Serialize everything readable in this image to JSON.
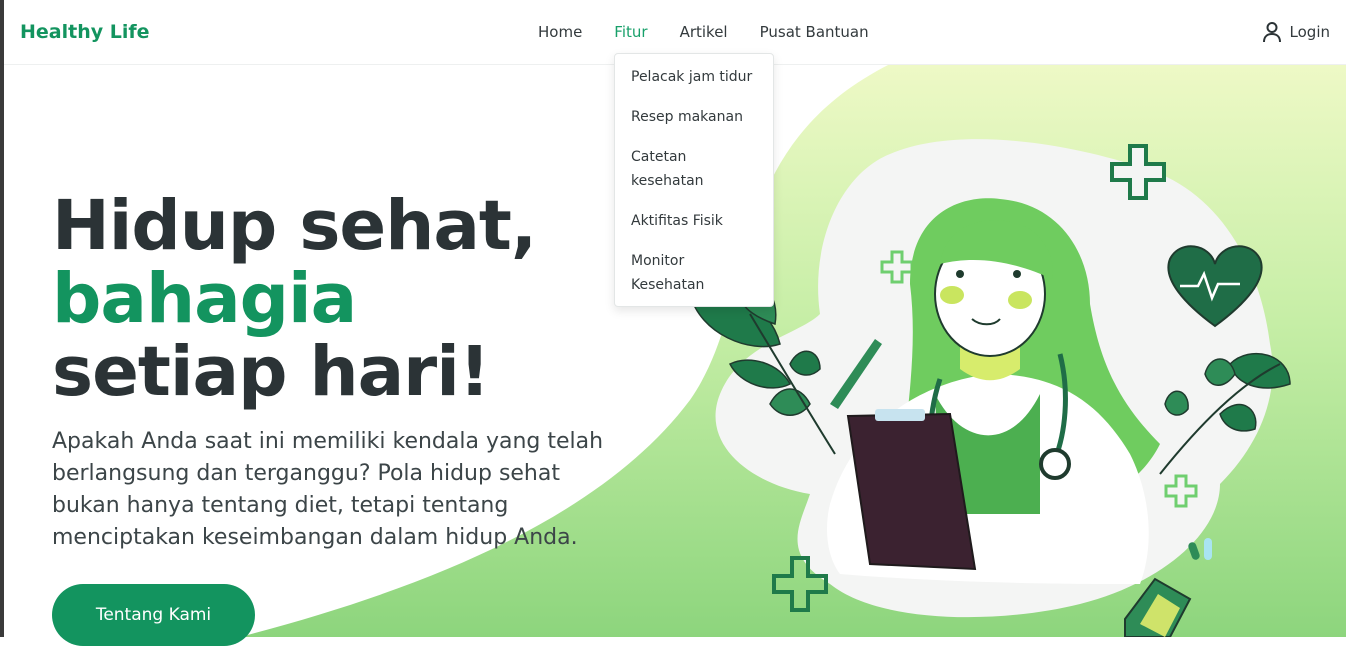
{
  "brand": "Healthy Life",
  "nav": {
    "items": [
      {
        "label": "Home"
      },
      {
        "label": "Fitur"
      },
      {
        "label": "Artikel"
      },
      {
        "label": "Pusat Bantuan"
      }
    ],
    "active": "Fitur",
    "login_label": "Login"
  },
  "dropdown": {
    "items": [
      {
        "label": "Pelacak jam tidur"
      },
      {
        "label": "Resep makanan"
      },
      {
        "label": "Catetan kesehatan"
      },
      {
        "label": "Aktifitas Fisik"
      },
      {
        "label": "Monitor Kesehatan"
      }
    ]
  },
  "hero": {
    "headline_part1": "Hidup sehat,",
    "headline_accent": "bahagia",
    "headline_part2": " setiap hari!",
    "description": "Apakah Anda saat ini memiliki kendala yang telah berlangsung dan terganggu? Pola hidup sehat bukan hanya tentang diet, tetapi tentang menciptakan keseimbangan dalam hidup Anda.",
    "cta_label": "Tentang Kami"
  },
  "colors": {
    "brand": "#13945f",
    "active_link": "#18a06a",
    "hero_gradient_top": "#eef9c8",
    "hero_gradient_bottom": "#8fd67a"
  },
  "icons": {
    "login": "user-icon"
  }
}
